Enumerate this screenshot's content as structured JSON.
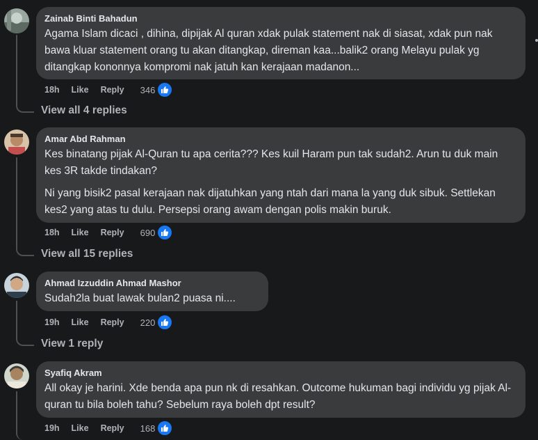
{
  "comments": [
    {
      "author": "Zainab Binti Bahadun",
      "lines": [
        "Agama Islam dicaci , dihina, dipijak Al quran xdak pulak statement nak di siasat, xdak pun nak bawa kluar statement orang tu akan ditangkap, direman kaa...balik2 orang Melayu pulak yg ditangkap kononnya kompromi nak jatuh kan kerajaan madanon..."
      ],
      "time": "18h",
      "like": "Like",
      "reply": "Reply",
      "reactions": "346",
      "view_replies": "View all 4 replies"
    },
    {
      "author": "Amar Abd Rahman",
      "lines": [
        "Kes binatang pijak Al-Quran tu apa cerita??? Kes kuil Haram pun tak sudah2. Arun tu duk main kes 3R takde tindakan?",
        "Ni yang bisik2 pasal kerajaan nak dijatuhkan yang ntah dari mana la yang duk sibuk. Settlekan kes2 yang atas tu dulu. Persepsi orang awam dengan polis makin buruk."
      ],
      "time": "18h",
      "like": "Like",
      "reply": "Reply",
      "reactions": "690",
      "view_replies": "View all 15 replies"
    },
    {
      "author": "Ahmad Izzuddin Ahmad Mashor",
      "lines": [
        "Sudah2la buat lawak bulan2 puasa ni...."
      ],
      "time": "19h",
      "like": "Like",
      "reply": "Reply",
      "reactions": "220",
      "view_replies": "View 1 reply"
    },
    {
      "author": "Syafiq Akram",
      "lines": [
        "All okay je harini. Xde benda apa pun nk di resahkan. Outcome hukuman bagi individu yg pijak Al-quran tu bila boleh tahu? Sebelum raya boleh dpt result?"
      ],
      "time": "19h",
      "like": "Like",
      "reply": "Reply",
      "reactions": "168"
    }
  ],
  "icons": {
    "reaction": "like-thumb-icon"
  },
  "colors": {
    "background": "#18191a",
    "bubble": "#3a3b3c",
    "like_badge": "#1877f2"
  }
}
